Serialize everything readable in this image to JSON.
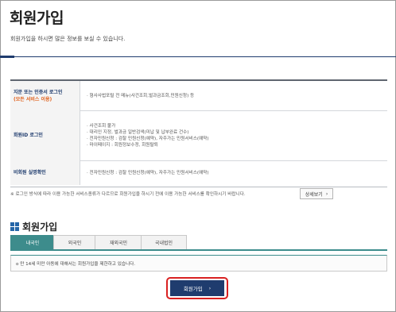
{
  "page": {
    "title": "회원가입",
    "subtitle": "회원가입을 하시면 많은 정보를 보실 수 있습니다."
  },
  "login_types": [
    {
      "head": "지문 또는 인증서 로그인",
      "head_note": "(모든 서비스 이용)",
      "items": [
        "· 형사사법포털 전 메뉴(사건조회,벌과금조회,민원신청) 등"
      ]
    },
    {
      "head": "회원ID 로그인",
      "head_note": "",
      "items": [
        "· 사건조회 불가",
        "· 대리인 지정, 벌과금 일반검색(미납 및 납부완료 건수)",
        "· 전자민원신청 : 검찰 민원신청(예약), 자주가는 민원서비스(예약)",
        "· 마이페이지 : 회원정보수정, 회원탈퇴"
      ]
    },
    {
      "head": "비회원 실명확인",
      "head_note": "",
      "items": [
        "· 전자민원신청 : 검찰 민원신청(예약), 자주가는 민원서비스(예약)"
      ]
    }
  ],
  "notice": {
    "text": "※ 로그인 방식에 따라 이용 가능한 서비스종류가 다르므로 회원가입을 하시기 전에 이용 가능한 서비스를 확인하시기 바랍니다.",
    "detail_label": "상세보기",
    "detail_arrow": "›"
  },
  "section": {
    "title": "회원가입"
  },
  "tabs": [
    {
      "label": "내국인",
      "active": true
    },
    {
      "label": "외국인",
      "active": false
    },
    {
      "label": "재외국민",
      "active": false
    },
    {
      "label": "국내법인",
      "active": false
    }
  ],
  "tab_content": "o 만 14세 미만 아동에 대해서는 회원가입을 제한하고 있습니다.",
  "join_button": {
    "label": "회원가입",
    "arrow": "›"
  },
  "colors": {
    "navy": "#1f3c6e",
    "teal": "#3d8c8c",
    "orange": "#e0611c",
    "highlight_red": "#d92121"
  }
}
